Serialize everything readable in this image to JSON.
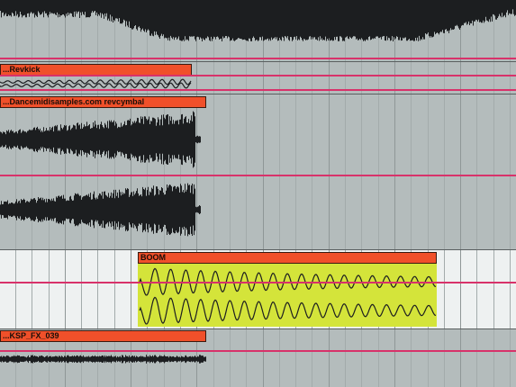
{
  "arrangement": {
    "clips": [
      {
        "id": "revkick",
        "name": "...Revkick"
      },
      {
        "id": "revcymbal",
        "name": "...Dancemidisamples.com revcymbal"
      },
      {
        "id": "boom",
        "name": "BOOM"
      },
      {
        "id": "ksp",
        "name": "...KSP_FX_039"
      }
    ],
    "colors": {
      "lane_bg": "#b4bcbc",
      "lane_bg_light": "#eef1f1",
      "clip_header": "#f0502a",
      "clip_selected_body": "#d4e43a",
      "waveform": "#1c1e20",
      "locator_line": "#d8326a"
    }
  }
}
